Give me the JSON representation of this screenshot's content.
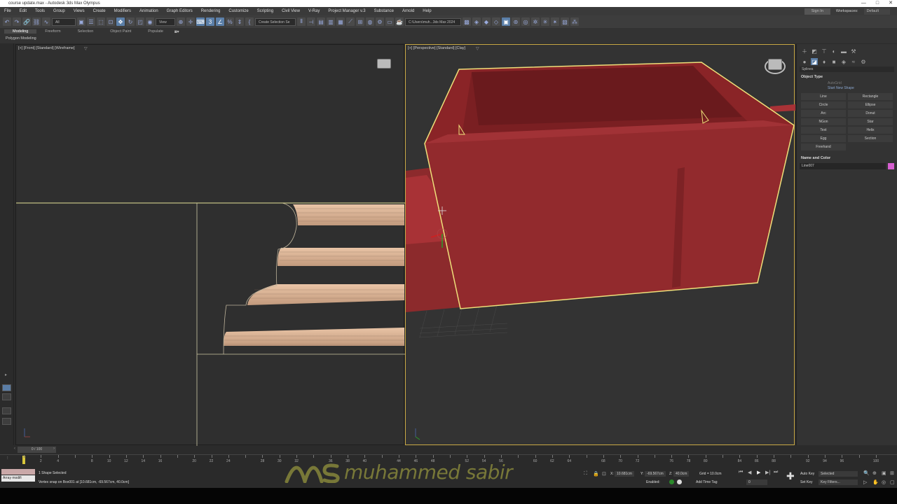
{
  "window": {
    "title": "course update.max - Autodesk 3ds Max Olympus",
    "controls": [
      "—",
      "□",
      "✕"
    ]
  },
  "menu": {
    "items": [
      "File",
      "Edit",
      "Tools",
      "Group",
      "Views",
      "Create",
      "Modifiers",
      "Animation",
      "Graph Editors",
      "Rendering",
      "Customize",
      "Scripting",
      "Civil View",
      "V-Ray",
      "Project Manager v.3",
      "Substance",
      "Arnold",
      "Help"
    ],
    "sign_in": "Sign In",
    "workspaces_label": "Workspaces:",
    "workspace_value": "Default"
  },
  "toolbar": {
    "filter_value": "All",
    "view_value": "View",
    "selection_set_placeholder": "Create Selection Se",
    "path_value": "C:\\Users\\muh...3ds Max 2024"
  },
  "ribbon": {
    "tabs": [
      "Modeling",
      "Freeform",
      "Selection",
      "Object Paint",
      "Populate"
    ],
    "active_tab": "Modeling",
    "subtitle": "Polygon Modeling"
  },
  "viewports": {
    "front_label": "[+] [Front] [Standard] [Wireframe]",
    "persp_label": "[+] [Perspective] [Standard] [Clay]"
  },
  "command_panel": {
    "category": "Splines",
    "object_type_header": "Object Type",
    "autogrid": "AutoGrid",
    "start_new_shape": "Start New Shape",
    "buttons": [
      "Line",
      "Rectangle",
      "Circle",
      "Ellipse",
      "Arc",
      "Donut",
      "NGon",
      "Star",
      "Text",
      "Helix",
      "Egg",
      "Section",
      "Freehand"
    ],
    "name_color_header": "Name and Color",
    "object_name": "Line007",
    "object_color": "#d65fd0"
  },
  "timeline": {
    "slider_text": "0 / 100",
    "ticks": [
      0,
      2,
      4,
      6,
      8,
      10,
      12,
      14,
      16,
      18,
      20,
      22,
      24,
      26,
      28,
      30,
      32,
      34,
      36,
      38,
      40,
      42,
      44,
      46,
      48,
      50,
      52,
      54,
      56,
      58,
      60,
      62,
      64,
      66,
      68,
      70,
      72,
      74,
      76,
      78,
      80,
      82,
      84,
      86,
      88,
      90,
      92,
      94,
      96,
      98,
      100
    ],
    "labels": [
      2,
      4,
      8,
      10,
      12,
      14,
      16,
      20,
      22,
      24,
      28,
      30,
      32,
      36,
      38,
      40,
      44,
      46,
      48,
      52,
      54,
      56,
      60,
      62,
      64,
      68,
      70,
      72,
      76,
      78,
      80,
      84,
      86,
      88,
      92,
      94,
      96,
      100
    ]
  },
  "status": {
    "maxscript_placeholder": "Array modifi",
    "selection_count": "1 Shape Selected",
    "prompt": "Vertex snap on Box001 at [10.681cm, -69.567cm, 40.0cm]",
    "x_label": "X:",
    "x": "10.681cm",
    "y_label": "Y:",
    "y": "-69.567cm",
    "z_label": "Z:",
    "z": "40.0cm",
    "grid": "Grid = 10.0cm",
    "enabled_label": "Enabled:",
    "add_time_tag": "Add Time Tag",
    "auto_key": "Auto Key",
    "set_key": "Set Key",
    "key_mode": "Selected",
    "key_filters": "Key Filters...",
    "frame": "0"
  },
  "watermark": {
    "text": "muhammed sabir"
  }
}
